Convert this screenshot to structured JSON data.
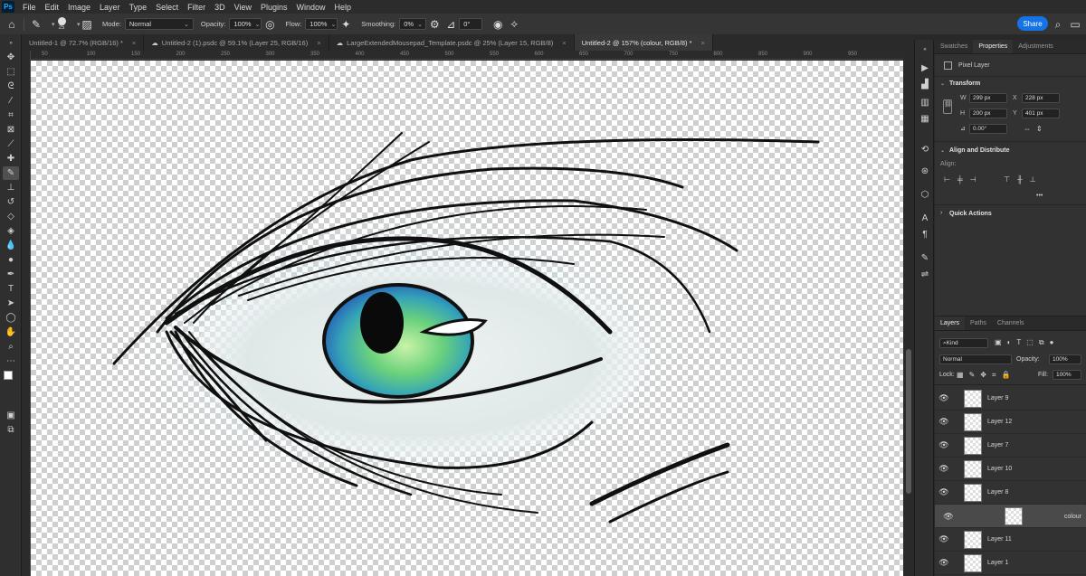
{
  "menubar": {
    "logo": "Ps",
    "items": [
      "File",
      "Edit",
      "Image",
      "Layer",
      "Type",
      "Select",
      "Filter",
      "3D",
      "View",
      "Plugins",
      "Window",
      "Help"
    ]
  },
  "options": {
    "brush_size": "25",
    "mode_label": "Mode:",
    "mode_value": "Normal",
    "opacity_label": "Opacity:",
    "opacity_value": "100%",
    "flow_label": "Flow:",
    "flow_value": "100%",
    "smoothing_label": "Smoothing:",
    "smoothing_value": "0%",
    "angle_value": "0°",
    "share_label": "Share"
  },
  "tabs": [
    {
      "label": "Untitled-1 @ 72.7% (RGB/16) *",
      "active": false,
      "cloud": false
    },
    {
      "label": "Untitled-2 (1).psdc @ 59.1% (Layer 25, RGB/16)",
      "active": false,
      "cloud": true
    },
    {
      "label": "LargeExtendedMousepad_Template.psdc @ 25% (Layer 15, RGB/8)",
      "active": false,
      "cloud": true
    },
    {
      "label": "Untitled-2 @ 157% (colour, RGB/8) *",
      "active": true,
      "cloud": false
    }
  ],
  "ruler_ticks": [
    "50",
    "100",
    "150",
    "200",
    "250",
    "300",
    "350",
    "400",
    "450",
    "500",
    "550",
    "600",
    "650",
    "700",
    "750",
    "800",
    "850",
    "900",
    "950"
  ],
  "properties": {
    "tabs": [
      "Swatches",
      "Properties",
      "Adjustments"
    ],
    "active_tab": "Properties",
    "layer_type": "Pixel Layer",
    "transform_title": "Transform",
    "w_label": "W",
    "w_value": "299 px",
    "h_label": "H",
    "h_value": "200 px",
    "x_label": "X",
    "x_value": "228 px",
    "y_label": "Y",
    "y_value": "401 px",
    "angle_value": "0.00°",
    "align_title": "Align and Distribute",
    "align_label": "Align:",
    "more_label": "•••",
    "quick_actions_title": "Quick Actions"
  },
  "layers_panel": {
    "tabs": [
      "Layers",
      "Paths",
      "Channels"
    ],
    "active_tab": "Layers",
    "filter_kind": "Kind",
    "blend_mode": "Normal",
    "opacity_label": "Opacity:",
    "opacity_value": "100%",
    "lock_label": "Lock:",
    "fill_label": "Fill:",
    "fill_value": "100%",
    "layers": [
      {
        "name": "Layer 9",
        "selected": false
      },
      {
        "name": "Layer 12",
        "selected": false
      },
      {
        "name": "Layer 7",
        "selected": false
      },
      {
        "name": "Layer 10",
        "selected": false
      },
      {
        "name": "Layer 8",
        "selected": false
      },
      {
        "name": "colour",
        "selected": true
      },
      {
        "name": "Layer 11",
        "selected": false
      },
      {
        "name": "Layer 1",
        "selected": false
      }
    ]
  },
  "colors": {
    "accent": "#1473e6",
    "iris_inner": "#8fe07a",
    "iris_outer": "#3a9ad6",
    "line": "#101010"
  }
}
